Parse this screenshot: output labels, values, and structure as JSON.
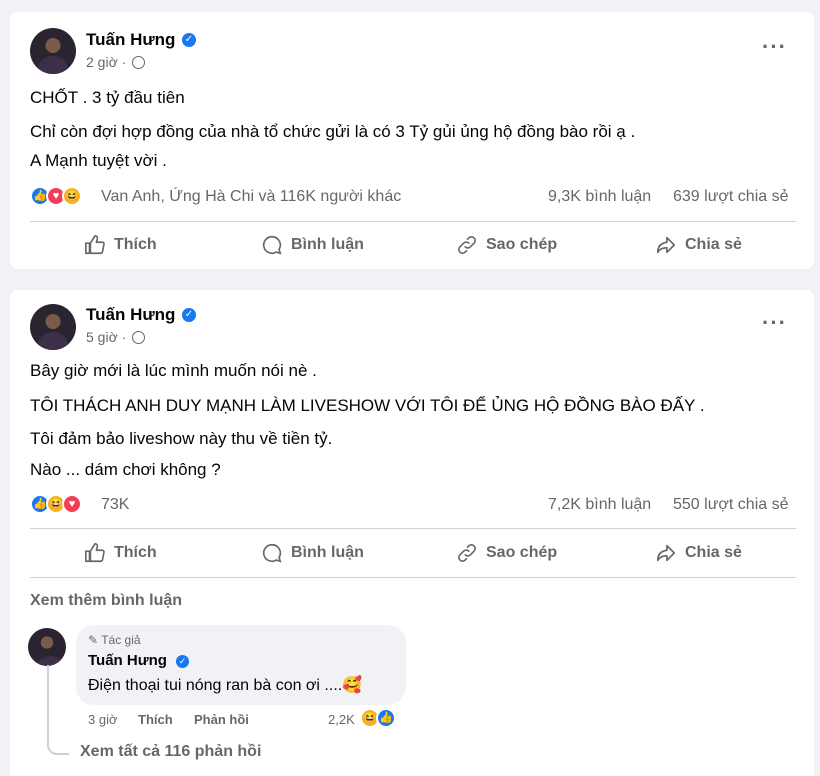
{
  "colors": {
    "brand": "#1877f2",
    "like": "#1877f2",
    "love": "#f33e58",
    "haha": "#f7b125",
    "muted": "#65676b"
  },
  "actions": {
    "like": "Thích",
    "comment": "Bình luận",
    "copy": "Sao chép",
    "share": "Chia sẻ"
  },
  "posts": [
    {
      "author": "Tuấn Hưng",
      "time": "2 giờ ·",
      "lines": [
        "CHỐT . 3 tỷ đầu tiên",
        "Chỉ còn đợi hợp đồng của nhà tổ chức gửi là có 3 Tỷ gủi ủng hộ đồng bào rồi ạ .",
        "A Mạnh tuyệt vời ."
      ],
      "reactions_icons": [
        "like-icon",
        "love-icon",
        "haha-icon"
      ],
      "reactions_text": "Van Anh, Ứng Hà Chi và 116K người khác",
      "comments": "9,3K bình luận",
      "shares": "639 lượt chia sẻ"
    },
    {
      "author": "Tuấn Hưng",
      "time": "5 giờ ·",
      "lines": [
        "Bây giờ mới là lúc mình muốn nói nè .",
        "TÔI THÁCH ANH DUY MẠNH LÀM LIVESHOW VỚI TÔI ĐỂ ỦNG HỘ ĐỒNG BÀO ĐẤY .",
        "Tôi đảm bảo liveshow này thu về tiền tỷ.",
        "Nào ... dám chơi không ?"
      ],
      "reactions_icons": [
        "like-icon",
        "haha-icon",
        "love-icon"
      ],
      "reactions_text": "73K",
      "comments": "7,2K bình luận",
      "shares": "550 lượt chia sẻ",
      "see_more_comments": "Xem thêm bình luận",
      "comment": {
        "author_tag": "Tác giả",
        "author": "Tuấn Hưng",
        "text": "Điện thoại tui nóng ran bà con ơi ....🥰",
        "time": "3 giờ",
        "like": "Thích",
        "reply": "Phản hồi",
        "reaction_count": "2,2K",
        "view_replies": "Xem tất cả 116 phản hồi"
      }
    }
  ]
}
